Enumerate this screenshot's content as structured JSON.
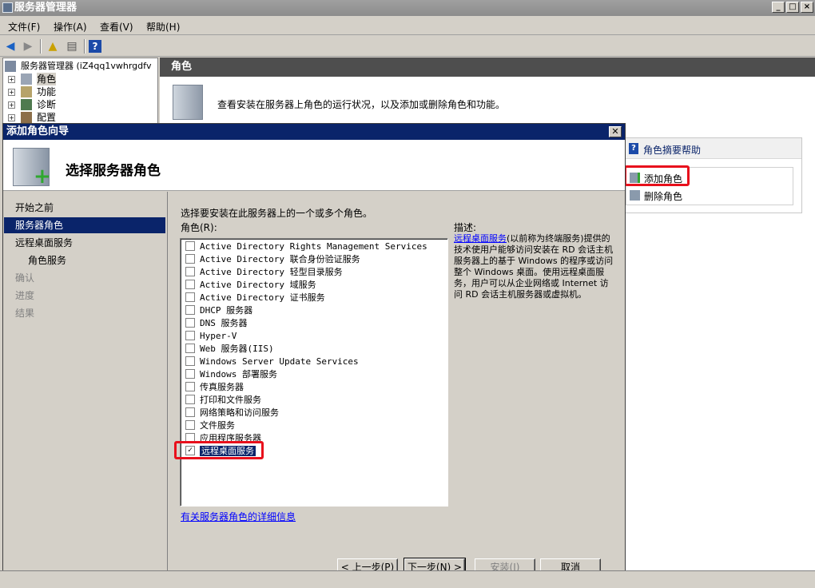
{
  "window": {
    "title": "服务器管理器"
  },
  "menu": [
    "文件(F)",
    "操作(A)",
    "查看(V)",
    "帮助(H)"
  ],
  "tree": {
    "root": "服务器管理器 (iZ4qq1vwhrgdfv",
    "items": [
      "角色",
      "功能",
      "诊断",
      "配置"
    ]
  },
  "roles_panel": {
    "header": "角色",
    "description": "查看安装在服务器上角色的运行状况，以及添加或删除角色和功能。"
  },
  "actions": {
    "help": "角色摘要帮助",
    "add": "添加角色",
    "remove": "删除角色"
  },
  "dialog": {
    "title": "添加角色向导",
    "heading": "选择服务器角色",
    "nav": [
      "开始之前",
      "服务器角色",
      "远程桌面服务",
      "角色服务",
      "确认",
      "进度",
      "结果"
    ],
    "instruction": "选择要安装在此服务器上的一个或多个角色。",
    "roles_label": "角色(R):",
    "desc_label": "描述:",
    "roles": [
      "Active Directory Rights Management Services",
      "Active Directory 联合身份验证服务",
      "Active Directory 轻型目录服务",
      "Active Directory 域服务",
      "Active Directory 证书服务",
      "DHCP 服务器",
      "DNS 服务器",
      "Hyper-V",
      "Web 服务器(IIS)",
      "Windows Server Update Services",
      "Windows 部署服务",
      "传真服务器",
      "打印和文件服务",
      "网络策略和访问服务",
      "文件服务",
      "应用程序服务器",
      "远程桌面服务"
    ],
    "checked_index": 16,
    "description_link": "远程桌面服务",
    "description_text": "(以前称为终端服务)提供的技术使用户能够访问安装在 RD 会话主机服务器上的基于 Windows 的程序或访问整个 Windows 桌面。使用远程桌面服务，用户可以从企业网络或 Internet 访问 RD 会话主机服务器或虚拟机。",
    "more_link": "有关服务器角色的详细信息",
    "buttons": {
      "prev": "< 上一步(P)",
      "next": "下一步(N) >",
      "install": "安装(I)",
      "cancel": "取消"
    }
  }
}
